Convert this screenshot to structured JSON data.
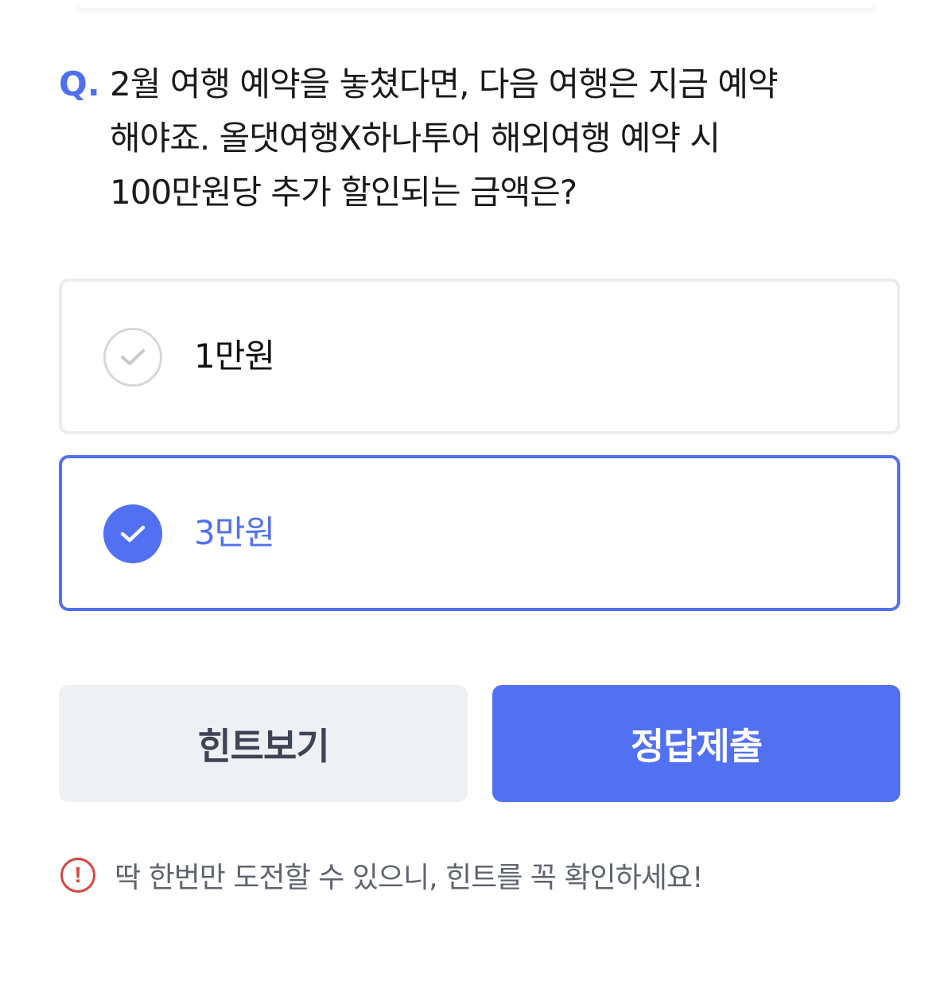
{
  "question": {
    "prefix": "Q.",
    "lines": [
      "2월 여행 예약을 놓쳤다면, 다음 여행은 지금 예약",
      "해야죠. 올댓여행X하나투어 해외여행 예약 시",
      "100만원당 추가 할인되는 금액은?"
    ]
  },
  "options": [
    {
      "label": "1만원",
      "selected": false,
      "icon": "check-icon"
    },
    {
      "label": "3만원",
      "selected": true,
      "icon": "check-icon"
    }
  ],
  "buttons": {
    "hint_label": "힌트보기",
    "submit_label": "정답제출"
  },
  "notice": {
    "icon": "exclamation-icon",
    "icon_glyph": "!",
    "text": "딱 한번만 도전할 수 있으니, 힌트를 꼭 확인하세요!"
  },
  "colors": {
    "accent": "#5270f2",
    "question_prefix": "#4f6ff0",
    "warning": "#d9443e",
    "hint_button_bg": "#eef0f4"
  }
}
